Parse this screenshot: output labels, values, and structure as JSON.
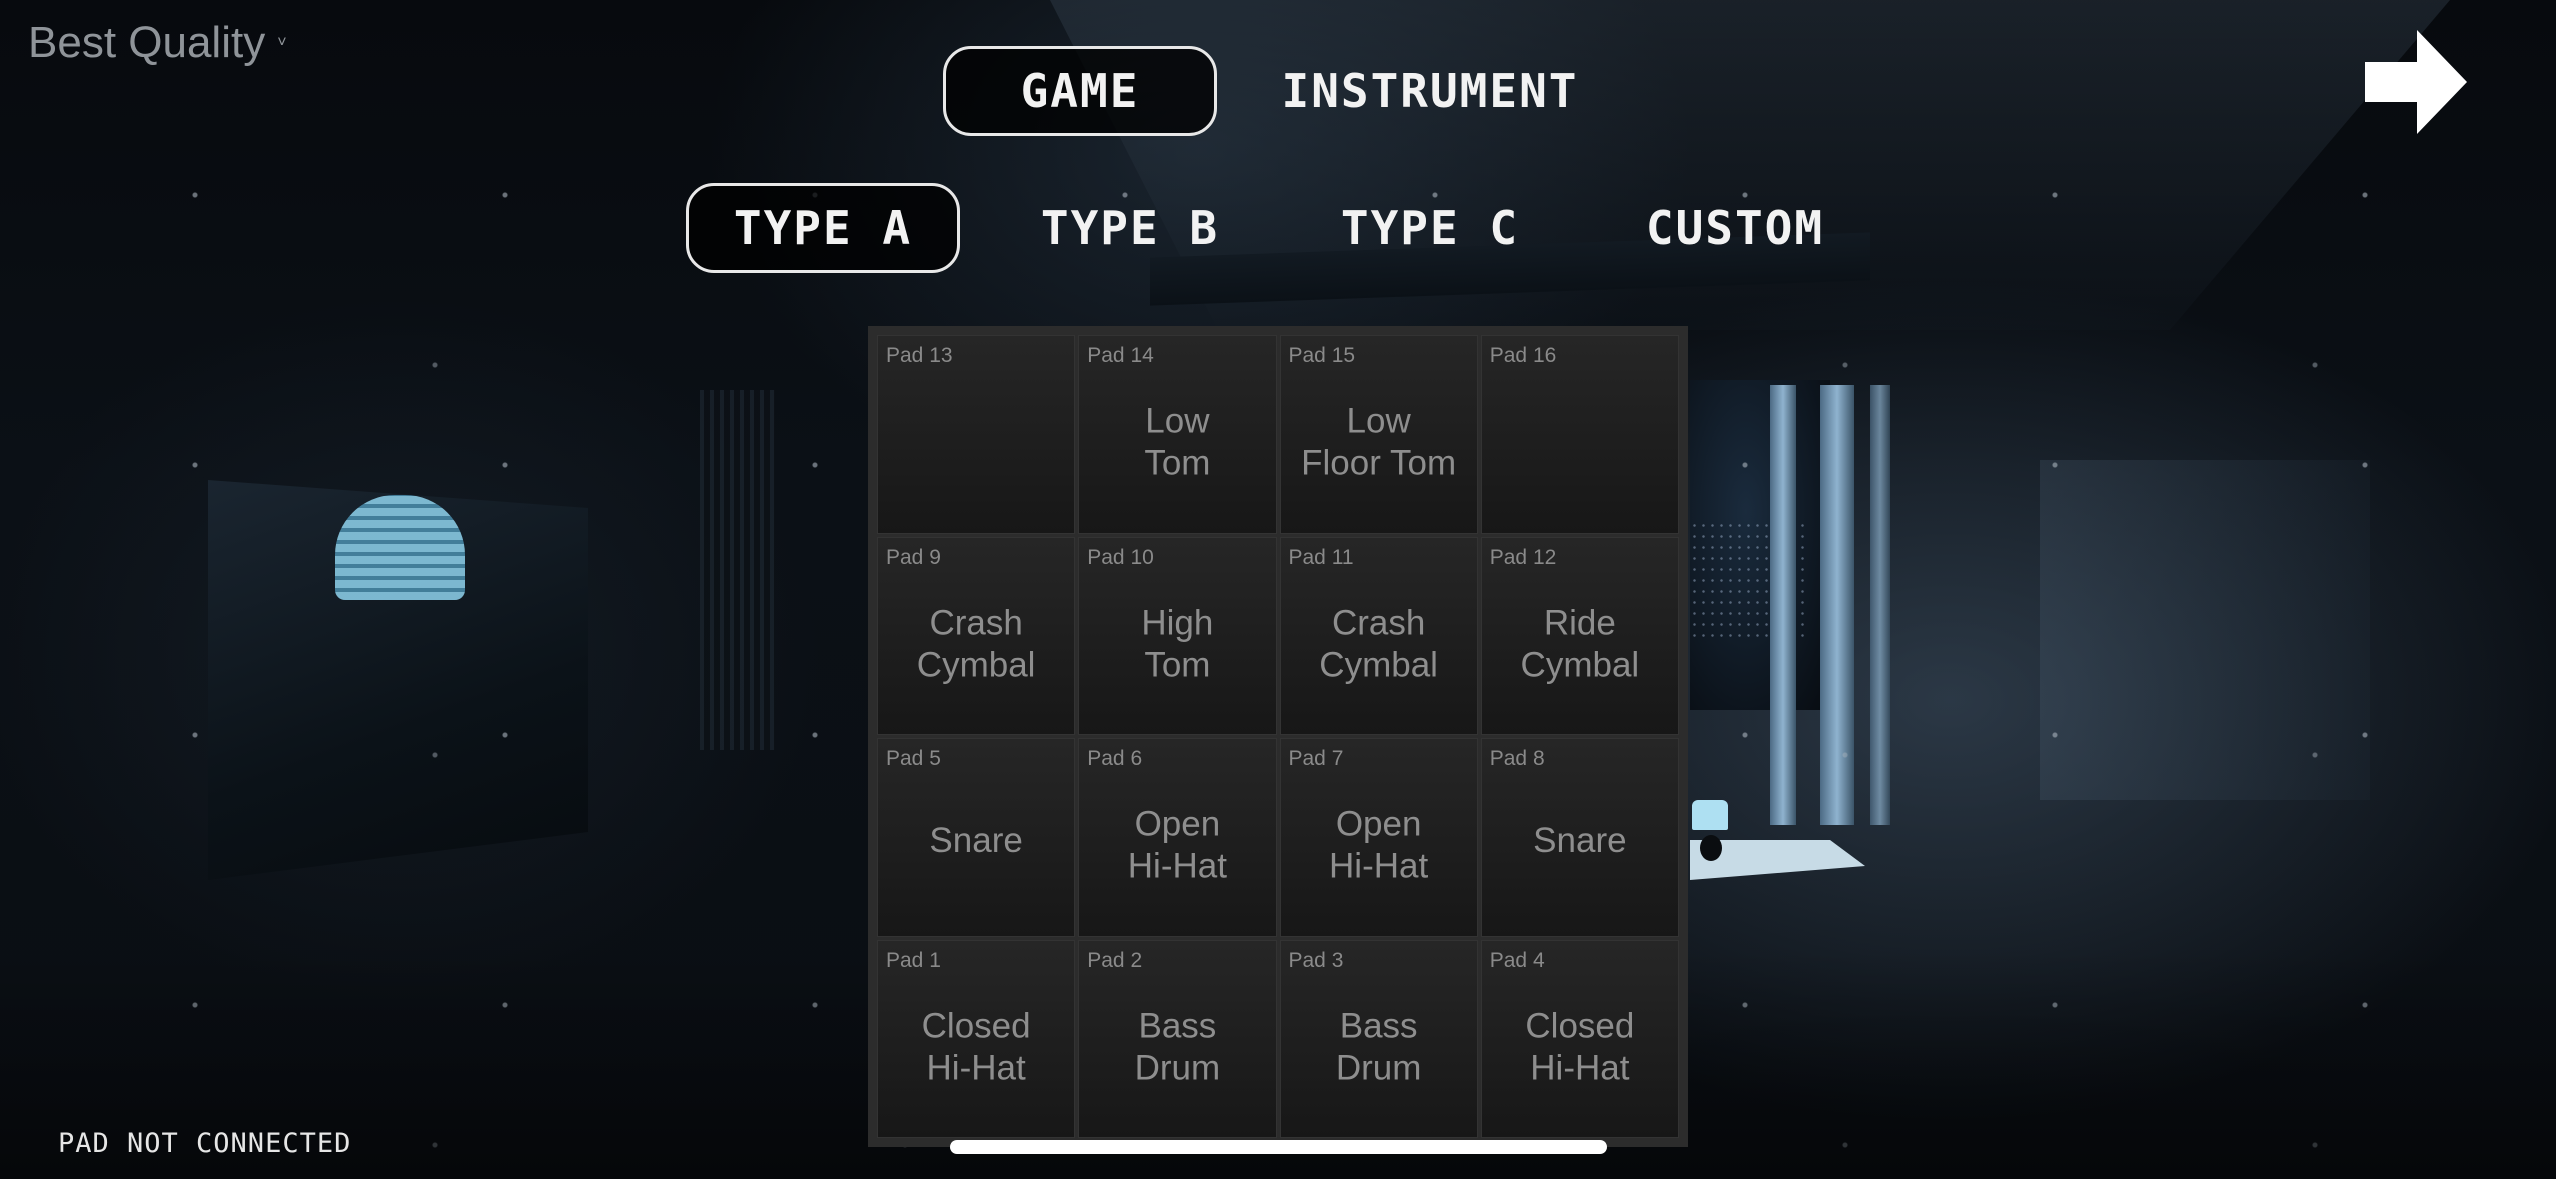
{
  "quality": {
    "label": "Best Quality",
    "caret": "˅"
  },
  "tabs": [
    {
      "id": "game",
      "label": "GAME",
      "active": true
    },
    {
      "id": "instrument",
      "label": "INSTRUMENT",
      "active": false
    }
  ],
  "types": [
    {
      "id": "type_a",
      "label": "TYPE A",
      "active": true
    },
    {
      "id": "type_b",
      "label": "TYPE B",
      "active": false
    },
    {
      "id": "type_c",
      "label": "TYPE C",
      "active": false
    },
    {
      "id": "custom",
      "label": "CUSTOM",
      "active": false
    }
  ],
  "next_button": {
    "icon": "arrow-right-icon",
    "color": "#ffffff"
  },
  "pads": [
    {
      "num": "Pad 13",
      "name": ""
    },
    {
      "num": "Pad 14",
      "name": "Low\nTom"
    },
    {
      "num": "Pad 15",
      "name": "Low\nFloor Tom"
    },
    {
      "num": "Pad 16",
      "name": ""
    },
    {
      "num": "Pad 9",
      "name": "Crash\nCymbal"
    },
    {
      "num": "Pad 10",
      "name": "High\nTom"
    },
    {
      "num": "Pad 11",
      "name": "Crash\nCymbal"
    },
    {
      "num": "Pad 12",
      "name": "Ride\nCymbal"
    },
    {
      "num": "Pad 5",
      "name": "Snare"
    },
    {
      "num": "Pad 6",
      "name": "Open\nHi-Hat"
    },
    {
      "num": "Pad 7",
      "name": "Open\nHi-Hat"
    },
    {
      "num": "Pad 8",
      "name": "Snare"
    },
    {
      "num": "Pad 1",
      "name": "Closed\nHi-Hat"
    },
    {
      "num": "Pad 2",
      "name": "Bass\nDrum"
    },
    {
      "num": "Pad 3",
      "name": "Bass\nDrum"
    },
    {
      "num": "Pad 4",
      "name": "Closed\nHi-Hat"
    }
  ],
  "status": {
    "text": "PAD NOT CONNECTED"
  },
  "colors": {
    "pad_text": "#8e8e8e",
    "tab_border": "#e8e8e8",
    "grid_frame": "#2c2c2c"
  }
}
